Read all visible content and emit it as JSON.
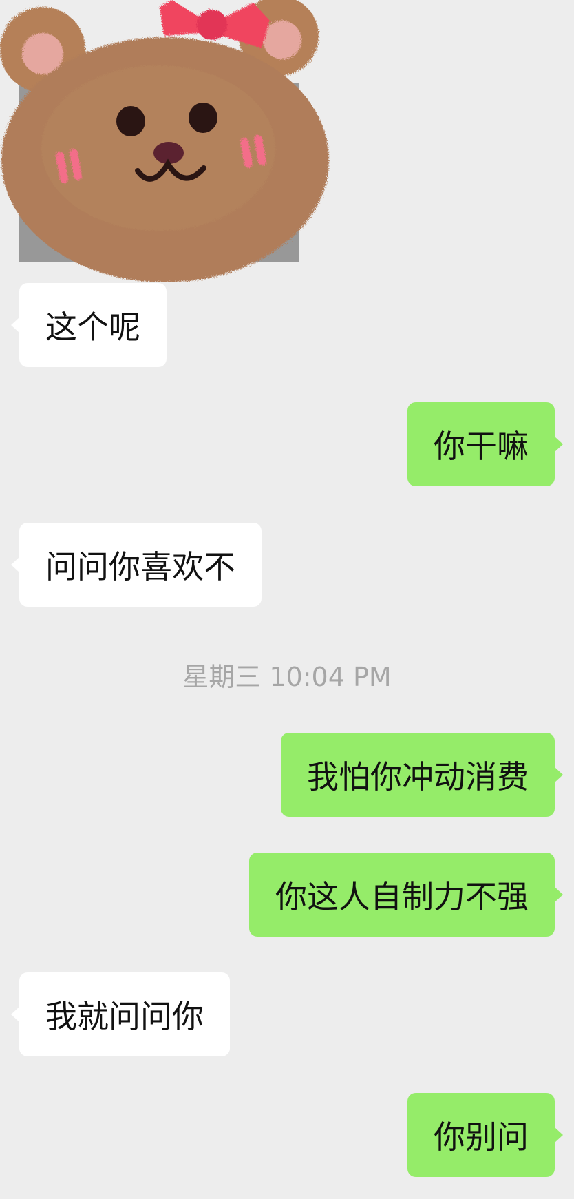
{
  "sticker": {
    "icon": "bear-face-sticker",
    "colors": {
      "fur": "#b07d5a",
      "ear_inner": "#e7a7a1",
      "bow": "#f0455f",
      "cheek": "#f26f87",
      "eyes": "#2a1513",
      "nose": "#5b2230"
    }
  },
  "messages": [
    {
      "side": "left",
      "text": "这个呢"
    },
    {
      "side": "right",
      "text": "你干嘛"
    },
    {
      "side": "left",
      "text": "问问你喜欢不"
    },
    {
      "side": "right",
      "text": "我怕你冲动消费"
    },
    {
      "side": "right",
      "text": "你这人自制力不强"
    },
    {
      "side": "left",
      "text": "我就问问你"
    },
    {
      "side": "right",
      "text": "你别问"
    }
  ],
  "timestamp": "星期三 10:04 PM",
  "colors": {
    "background": "#ededed",
    "incoming_bubble": "#ffffff",
    "outgoing_bubble": "#95ec69",
    "timestamp_text": "#a6a6a6"
  }
}
